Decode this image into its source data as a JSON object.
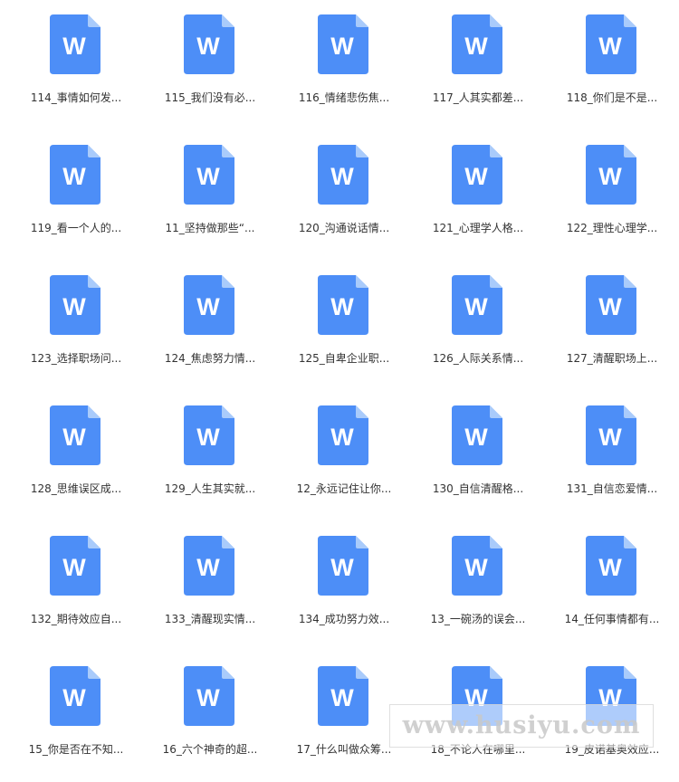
{
  "icon": {
    "name": "word-document-icon",
    "letter": "W",
    "color": "#4D8EF7",
    "fold_color": "#A9CBFB"
  },
  "files": [
    "114_事情如何发...",
    "115_我们没有必...",
    "116_情绪悲伤焦...",
    "117_人其实都差...",
    "118_你们是不是...",
    "119_看一个人的...",
    "11_坚持做那些“...",
    "120_沟通说话情...",
    "121_心理学人格...",
    "122_理性心理学...",
    "123_选择职场问...",
    "124_焦虑努力情...",
    "125_自卑企业职...",
    "126_人际关系情...",
    "127_清醒职场上...",
    "128_思维误区成...",
    "129_人生其实就...",
    "12_永远记住让你...",
    "130_自信清醒格...",
    "131_自信恋爱情...",
    "132_期待效应自...",
    "133_清醒现实情...",
    "134_成功努力效...",
    "13_一碗汤的误会...",
    "14_任何事情都有...",
    "15_你是否在不知...",
    "16_六个神奇的超...",
    "17_什么叫做众筹...",
    "18_不论人在哪里...",
    "19_皮诺基奥效应..."
  ],
  "watermark": "www.husiyu.com"
}
